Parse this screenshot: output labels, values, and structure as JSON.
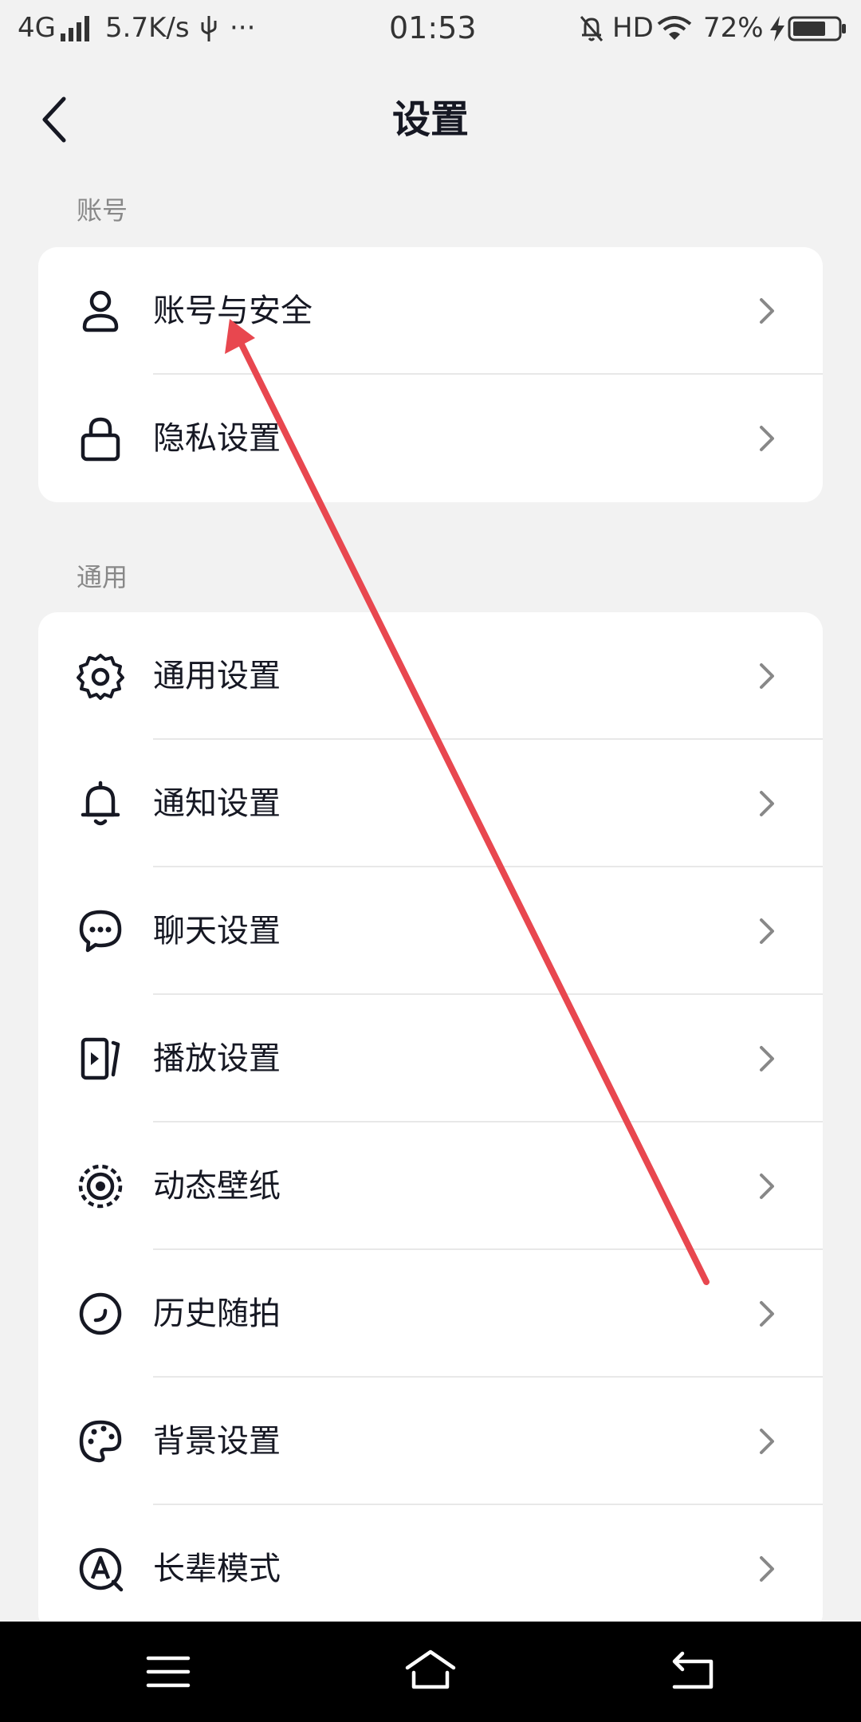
{
  "status_bar": {
    "network": "4G",
    "speed": "5.7K/s",
    "more": "···",
    "time": "01:53",
    "hd": "HD",
    "battery": "72%"
  },
  "header": {
    "title": "设置"
  },
  "sections": [
    {
      "label": "账号",
      "items": [
        {
          "label": "账号与安全",
          "icon": "person-icon"
        },
        {
          "label": "隐私设置",
          "icon": "lock-icon"
        }
      ]
    },
    {
      "label": "通用",
      "items": [
        {
          "label": "通用设置",
          "icon": "gear-icon"
        },
        {
          "label": "通知设置",
          "icon": "bell-icon"
        },
        {
          "label": "聊天设置",
          "icon": "chat-icon"
        },
        {
          "label": "播放设置",
          "icon": "play-icon"
        },
        {
          "label": "动态壁纸",
          "icon": "wallpaper-icon"
        },
        {
          "label": "历史随拍",
          "icon": "history-icon"
        },
        {
          "label": "背景设置",
          "icon": "palette-icon"
        },
        {
          "label": "长辈模式",
          "icon": "elder-mode-icon"
        }
      ]
    }
  ],
  "colors": {
    "annotation_arrow": "#e8474f",
    "background": "#f2f2f2",
    "card": "#ffffff"
  }
}
